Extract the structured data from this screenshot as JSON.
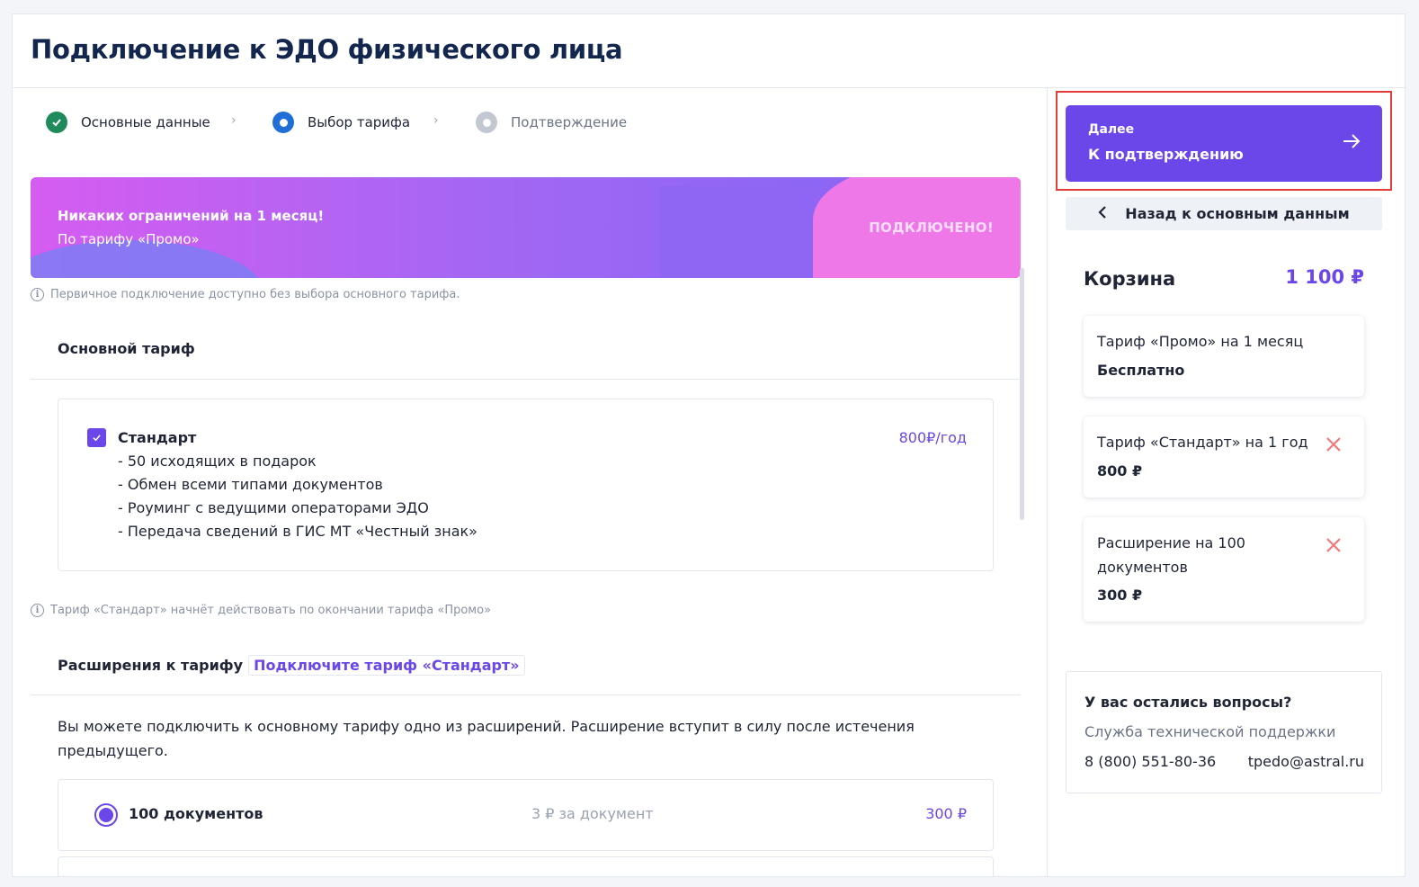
{
  "page": {
    "title": "Подключение к ЭДО физического лица"
  },
  "stepper": [
    {
      "label": "Основные данные",
      "state": "done"
    },
    {
      "label": "Выбор тарифа",
      "state": "active"
    },
    {
      "label": "Подтверждение",
      "state": "pending"
    }
  ],
  "banner": {
    "title": "Никаких ограничений на 1 месяц!",
    "subtitle": "По тарифу «Промо»",
    "status": "ПОДКЛЮЧЕНО!"
  },
  "info": {
    "primary": "Первичное подключение доступно без выбора основного тарифа.",
    "standard": "Тариф «Стандарт» начнёт действовать по окончании тарифа «Промо»"
  },
  "main_tariff": {
    "section_title": "Основной тариф",
    "name": "Стандарт",
    "price": "800₽/год",
    "checked": true,
    "features": [
      "- 50 исходящих в подарок",
      "- Обмен всеми типами документов",
      "- Роуминг с ведущими операторами ЭДО",
      "- Передача сведений в ГИС МТ «Честный знак»"
    ]
  },
  "extensions": {
    "section_title": "Расширения к тарифу",
    "link_label": "Подключите тариф «Стандарт»",
    "description": "Вы можете подключить к основному тарифу одно из расширений. Расширение вступит в силу после истечения предыдущего.",
    "items": [
      {
        "name": "100 документов",
        "unit_price": "3 ₽ за документ",
        "price": "300 ₽",
        "selected": true
      }
    ]
  },
  "sidebar": {
    "next_button": {
      "small": "Далее",
      "label": "К подтверждению"
    },
    "back_button": "Назад к основным данным",
    "cart": {
      "title": "Корзина",
      "total": "1 100 ₽",
      "items": [
        {
          "name": "Тариф «Промо» на 1 месяц",
          "price": "Бесплатно",
          "removable": false
        },
        {
          "name": "Тариф «Стандарт» на 1 год",
          "price": "800 ₽",
          "removable": true
        },
        {
          "name": "Расширение на 100 документов",
          "price": "300 ₽",
          "removable": true
        }
      ]
    },
    "support": {
      "title": "У вас остались вопросы?",
      "subtitle": "Служба технической поддержки",
      "phone": "8 (800) 551-80-36",
      "email": "tpedo@astral.ru"
    }
  },
  "colors": {
    "accent": "#6b46e8",
    "success": "#1f8a5b",
    "active_step": "#1f6fd6",
    "remove": "#f07a7a",
    "highlight": "#e53b3b"
  }
}
